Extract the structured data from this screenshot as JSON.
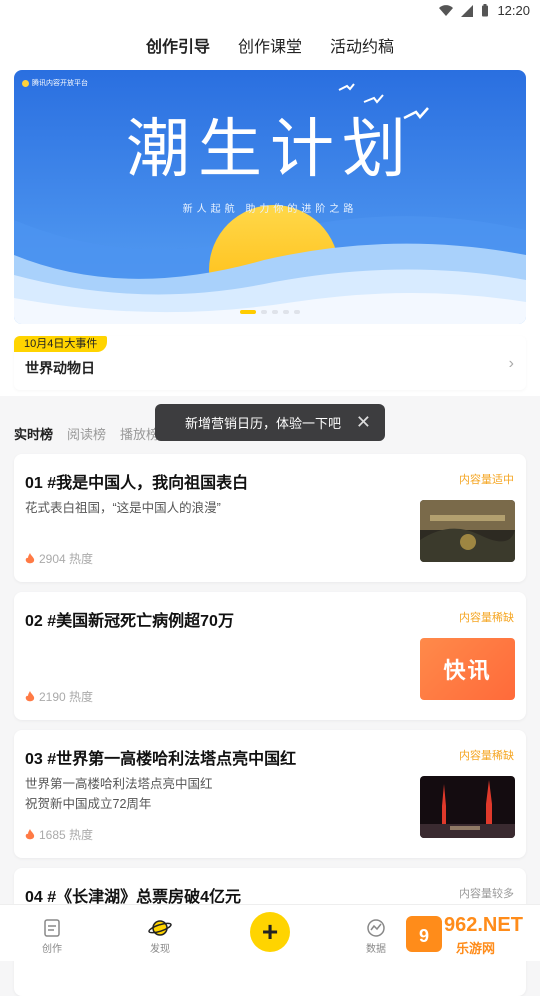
{
  "status": {
    "time": "12:20"
  },
  "top_tabs": [
    "创作引导",
    "创作课堂",
    "活动约稿"
  ],
  "banner": {
    "logo_text": "腾讯内容开放平台",
    "title": "潮生计划",
    "subtitle": "新人起航 助力你的进阶之路"
  },
  "event": {
    "tag": "10月4日大事件",
    "title": "世界动物日"
  },
  "rank_tabs": [
    "实时榜",
    "阅读榜",
    "播放榜"
  ],
  "tooltip": {
    "text": "新增营销日历，体验一下吧"
  },
  "cards": [
    {
      "title": "01 #我是中国人，我向祖国表白",
      "status": "内容量适中",
      "desc": "花式表白祖国，“这是中国人的浪漫”",
      "heat": "2904 热度"
    },
    {
      "title": "02 #美国新冠死亡病例超70万",
      "status": "内容量稀缺",
      "desc": "",
      "heat": "2190 热度",
      "thumb_text": "快讯"
    },
    {
      "title": "03 #世界第一高楼哈利法塔点亮中国红",
      "status": "内容量稀缺",
      "desc": "世界第一高楼哈利法塔点亮中国红 祝贺新中国成立72周年",
      "heat": "1685 热度"
    },
    {
      "title": "04 #《长津湖》总票房破4亿元",
      "status": "内容量较多"
    }
  ],
  "bottom_nav": [
    "创作",
    "发现",
    "数据"
  ],
  "watermark": {
    "brand": "962.NET",
    "sub": "乐游网"
  },
  "colors": {
    "accent": "#ffd400",
    "status_orange": "#f5a623",
    "banner_blue": "#2f7fe8"
  }
}
